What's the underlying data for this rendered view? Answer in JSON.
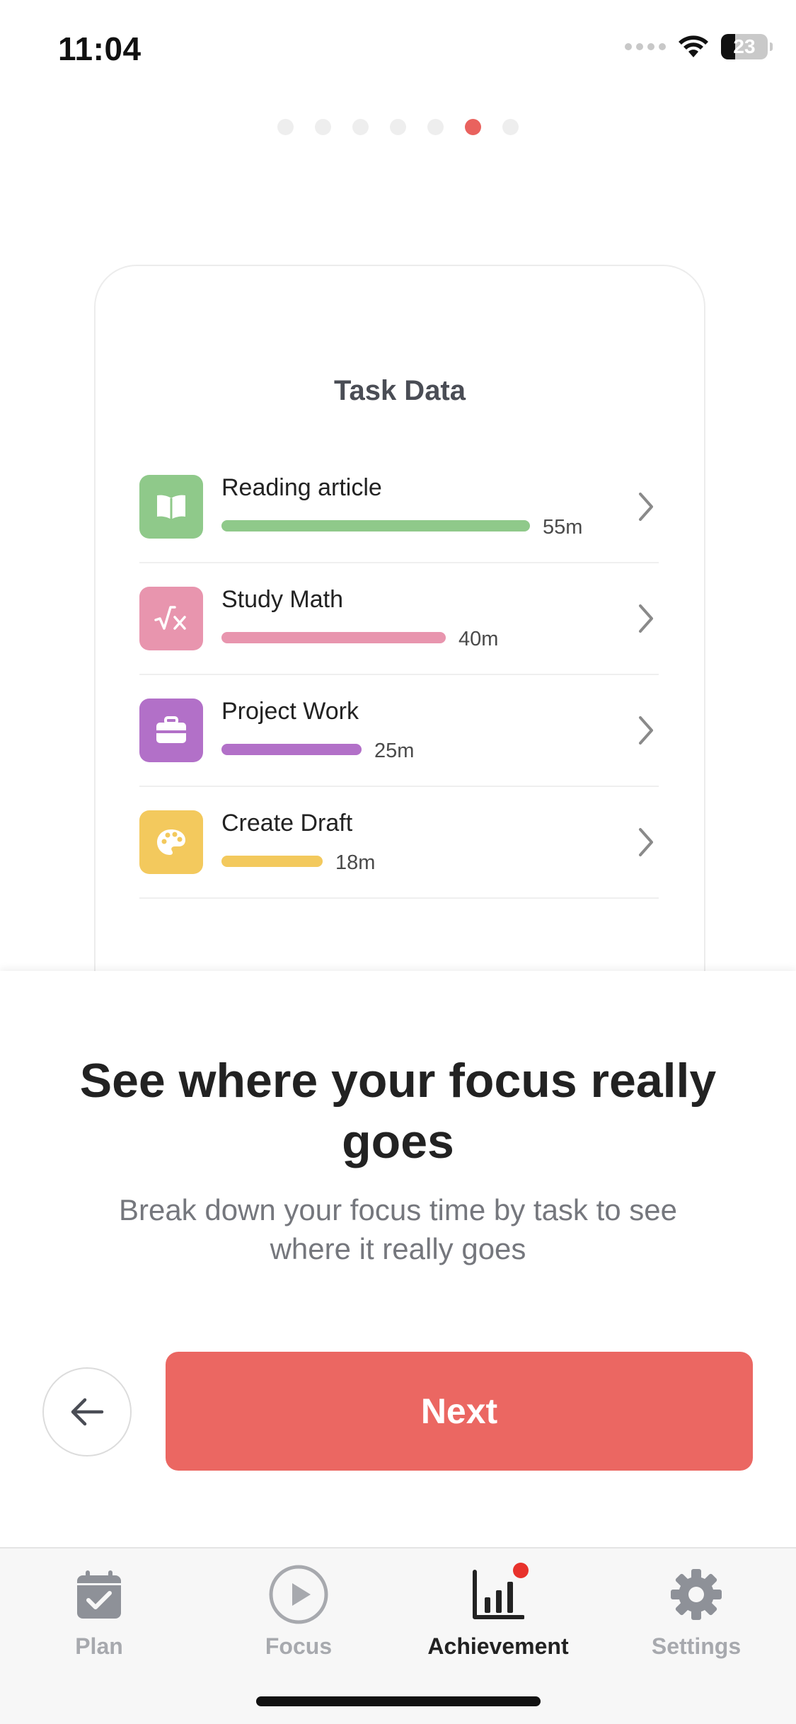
{
  "status_bar": {
    "time": "11:04",
    "battery_level": "23"
  },
  "pager": {
    "total": 7,
    "active_index": 5
  },
  "card": {
    "title": "Task Data",
    "tasks": [
      {
        "name": "Reading article",
        "time": "55m",
        "minutes": 55,
        "color": "#8fc98a",
        "icon": "book-icon"
      },
      {
        "name": "Study Math",
        "time": "40m",
        "minutes": 40,
        "color": "#e895ae",
        "icon": "math-root-icon"
      },
      {
        "name": "Project Work",
        "time": "25m",
        "minutes": 25,
        "color": "#b270c8",
        "icon": "briefcase-icon"
      },
      {
        "name": "Create Draft",
        "time": "18m",
        "minutes": 18,
        "color": "#f3c95d",
        "icon": "palette-icon"
      }
    ]
  },
  "sheet": {
    "headline": "See where your focus really goes",
    "subtext": "Break down your focus time by task to see where it really goes",
    "next_label": "Next"
  },
  "tabs": [
    {
      "label": "Plan",
      "icon": "calendar-check-icon",
      "active": false
    },
    {
      "label": "Focus",
      "icon": "play-circle-icon",
      "active": false
    },
    {
      "label": "Achievement",
      "icon": "bar-chart-icon",
      "active": true,
      "badge": true
    },
    {
      "label": "Settings",
      "icon": "gear-icon",
      "active": false
    }
  ],
  "colors": {
    "accent": "#eb6762",
    "active_dot": "#e9625e"
  }
}
